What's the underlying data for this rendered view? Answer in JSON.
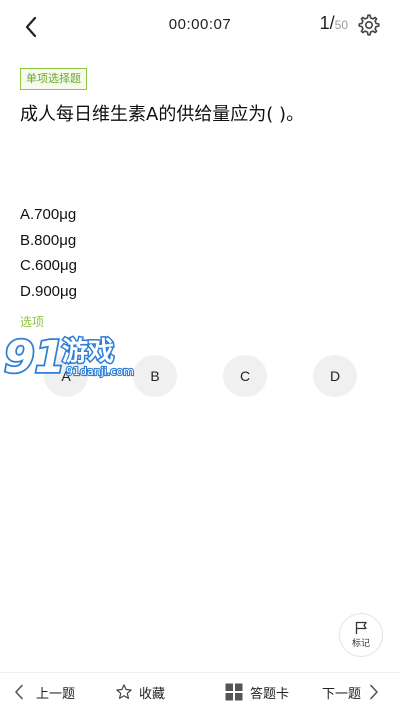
{
  "header": {
    "timer": "00:00:07",
    "progress_current": "1",
    "progress_separator": "/",
    "progress_total": "50"
  },
  "question": {
    "type_label": "单项选择题",
    "text": "成人每日维生素A的供给量应为( )。",
    "options": [
      "A.700μg",
      "B.800μg",
      "C.600μg",
      "D.900μg"
    ]
  },
  "answer": {
    "label": "选项",
    "choices": [
      "A",
      "B",
      "C",
      "D"
    ]
  },
  "watermark": {
    "brand": "游戏",
    "site": "91danji.com"
  },
  "mark": {
    "label": "标记"
  },
  "bottom_bar": {
    "prev_label": "上一题",
    "favorite_label": "收藏",
    "answer_card_label": "答题卡",
    "next_label": "下一题"
  },
  "colors": {
    "accent_green": "#8dc63f",
    "option_bg": "#f0f0f0",
    "watermark_blue": "#2f7fd6"
  }
}
